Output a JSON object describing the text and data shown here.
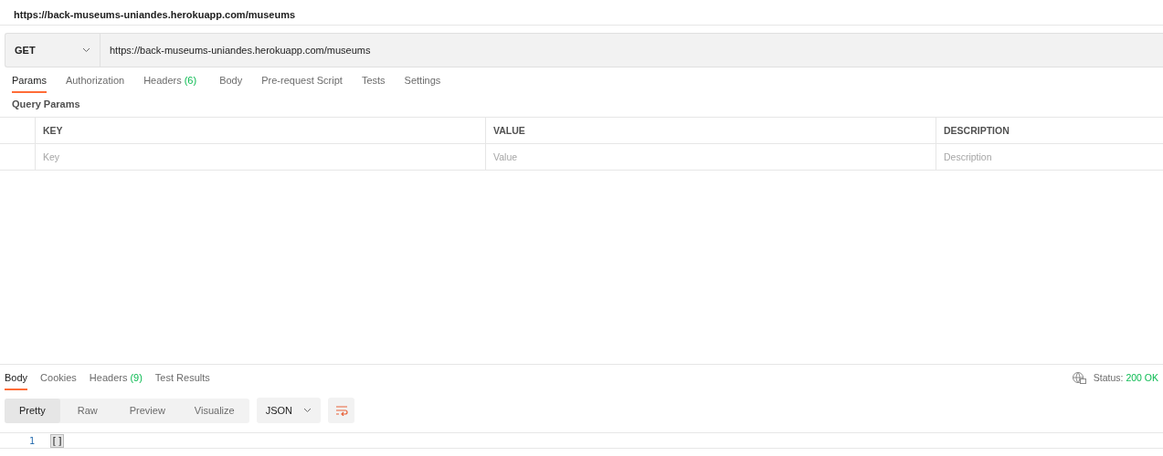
{
  "title": "https://back-museums-uniandes.herokuapp.com/museums",
  "request": {
    "method": "GET",
    "url": "https://back-museums-uniandes.herokuapp.com/museums"
  },
  "request_tabs": [
    {
      "label": "Params",
      "selected": true
    },
    {
      "label": "Authorization",
      "selected": false
    },
    {
      "label": "Headers",
      "count": "(6)",
      "selected": false
    },
    {
      "label": "Body",
      "selected": false
    },
    {
      "label": "Pre-request Script",
      "selected": false
    },
    {
      "label": "Tests",
      "selected": false
    },
    {
      "label": "Settings",
      "selected": false
    }
  ],
  "query_params": {
    "title": "Query Params",
    "columns": [
      "KEY",
      "VALUE",
      "DESCRIPTION"
    ],
    "placeholders": [
      "Key",
      "Value",
      "Description"
    ]
  },
  "response_tabs": [
    {
      "label": "Body",
      "selected": true
    },
    {
      "label": "Cookies",
      "selected": false
    },
    {
      "label": "Headers",
      "count": "(9)",
      "selected": false
    },
    {
      "label": "Test Results",
      "selected": false
    }
  ],
  "status": {
    "label": "Status:",
    "value": "200 OK"
  },
  "view_modes": [
    {
      "label": "Pretty",
      "selected": true
    },
    {
      "label": "Raw",
      "selected": false
    },
    {
      "label": "Preview",
      "selected": false
    },
    {
      "label": "Visualize",
      "selected": false
    }
  ],
  "format": "JSON",
  "code_lines": [
    {
      "number": "1",
      "text": "[]"
    }
  ]
}
